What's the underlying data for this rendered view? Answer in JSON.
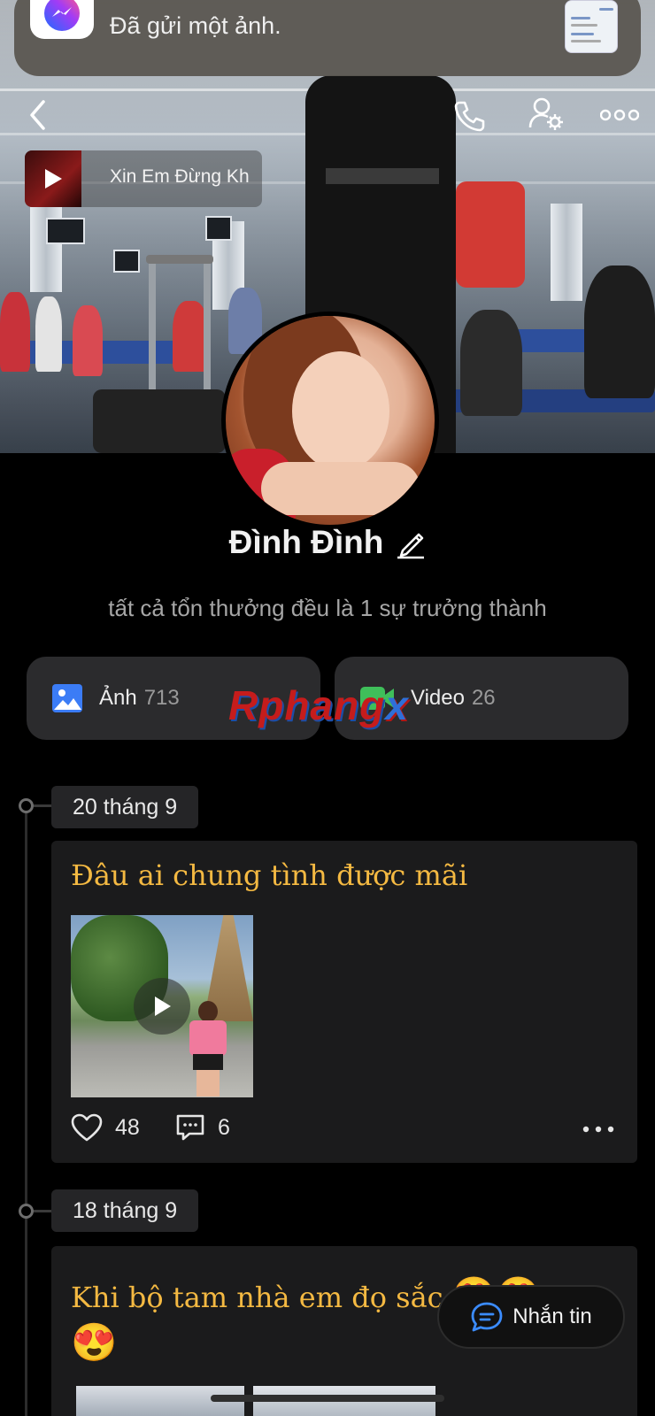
{
  "notification": {
    "app_icon": "messenger-icon",
    "text": "Đã gửi một ảnh."
  },
  "nav": {
    "back_icon": "chevron-left-icon",
    "call_icon": "phone-icon",
    "settings_icon": "user-settings-icon",
    "more_icon": "more-horizontal-icon"
  },
  "music": {
    "title": "Xin Em Đừng Kh",
    "icon": "play-icon"
  },
  "profile": {
    "name": "Đình Đình",
    "edit_icon": "pencil-icon",
    "bio": "tất cả tổn thưởng đều là 1 sự trưởng thành"
  },
  "tabs": [
    {
      "label": "Ảnh",
      "count": "713",
      "icon": "photo-icon",
      "color": "#3b7cf6"
    },
    {
      "label": "Video",
      "count": "26",
      "icon": "video-icon",
      "color": "#3fbf5a"
    }
  ],
  "watermark": {
    "part1": "Rphang",
    "part2": "x"
  },
  "posts": [
    {
      "date": "20 tháng 9",
      "title": "Đâu ai chung tình được mãi",
      "likes": "48",
      "comments": "6",
      "has_video": true
    },
    {
      "date": "18 tháng 9",
      "title_line1": "Khi bộ tam nhà em đọ sắc",
      "emoji": "😍"
    }
  ],
  "message_button": {
    "label": "Nhắn tin",
    "icon": "chat-bubble-icon"
  }
}
